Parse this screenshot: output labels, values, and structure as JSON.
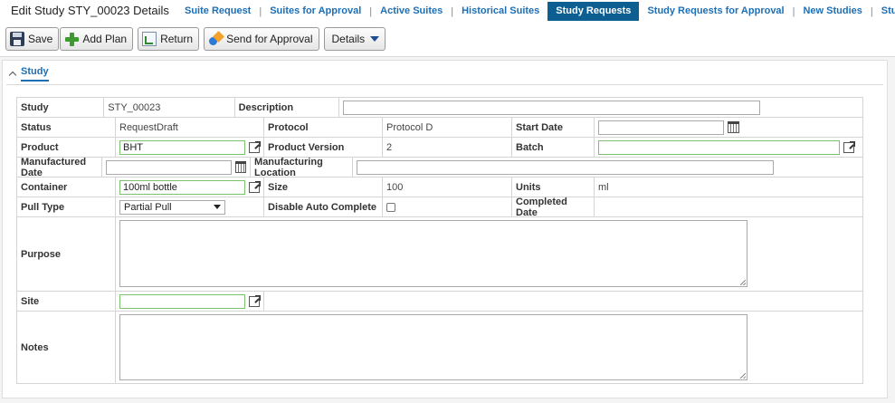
{
  "header": {
    "title": "Edit Study STY_00023 Details",
    "tabs": [
      {
        "label": "Suite Request",
        "active": false
      },
      {
        "label": "Suites for Approval",
        "active": false
      },
      {
        "label": "Active Suites",
        "active": false
      },
      {
        "label": "Historical Suites",
        "active": false
      },
      {
        "label": "Study Requests",
        "active": true
      },
      {
        "label": "Study Requests for Approval",
        "active": false
      },
      {
        "label": "New Studies",
        "active": false
      },
      {
        "label": "Stu",
        "active": false
      }
    ],
    "separator": "|"
  },
  "toolbar": {
    "save": "Save",
    "add_plan": "Add Plan",
    "return": "Return",
    "send_for_approval": "Send for Approval",
    "details": "Details"
  },
  "section": {
    "title": "Study"
  },
  "form": {
    "study_label": "Study",
    "study_value": "STY_00023",
    "description_label": "Description",
    "description_value": "",
    "status_label": "Status",
    "status_value": "RequestDraft",
    "protocol_label": "Protocol",
    "protocol_value": "Protocol D",
    "start_date_label": "Start Date",
    "start_date_value": "",
    "product_label": "Product",
    "product_value": "BHT",
    "product_version_label": "Product Version",
    "product_version_value": "2",
    "batch_label": "Batch",
    "batch_value": "",
    "manufactured_date_label": "Manufactured Date",
    "manufactured_date_value": "",
    "manufacturing_location_label": "Manufacturing Location",
    "manufacturing_location_value": "",
    "container_label": "Container",
    "container_value": "100ml bottle",
    "size_label": "Size",
    "size_value": "100",
    "units_label": "Units",
    "units_value": "ml",
    "pull_type_label": "Pull Type",
    "pull_type_value": "Partial Pull",
    "disable_auto_complete_label": "Disable Auto Complete",
    "disable_auto_complete_checked": false,
    "completed_date_label": "Completed Date",
    "completed_date_value": "",
    "purpose_label": "Purpose",
    "purpose_value": "",
    "site_label": "Site",
    "site_value": "",
    "notes_label": "Notes",
    "notes_value": ""
  },
  "colors": {
    "link": "#1d6fb5",
    "active_tab": "#0d5f92",
    "required_border": "#7cc070"
  },
  "icons": [
    "save-icon",
    "add-icon",
    "return-icon",
    "send-icon",
    "chevron-down-icon",
    "chevron-up-icon",
    "popout-icon",
    "calendar-icon"
  ]
}
